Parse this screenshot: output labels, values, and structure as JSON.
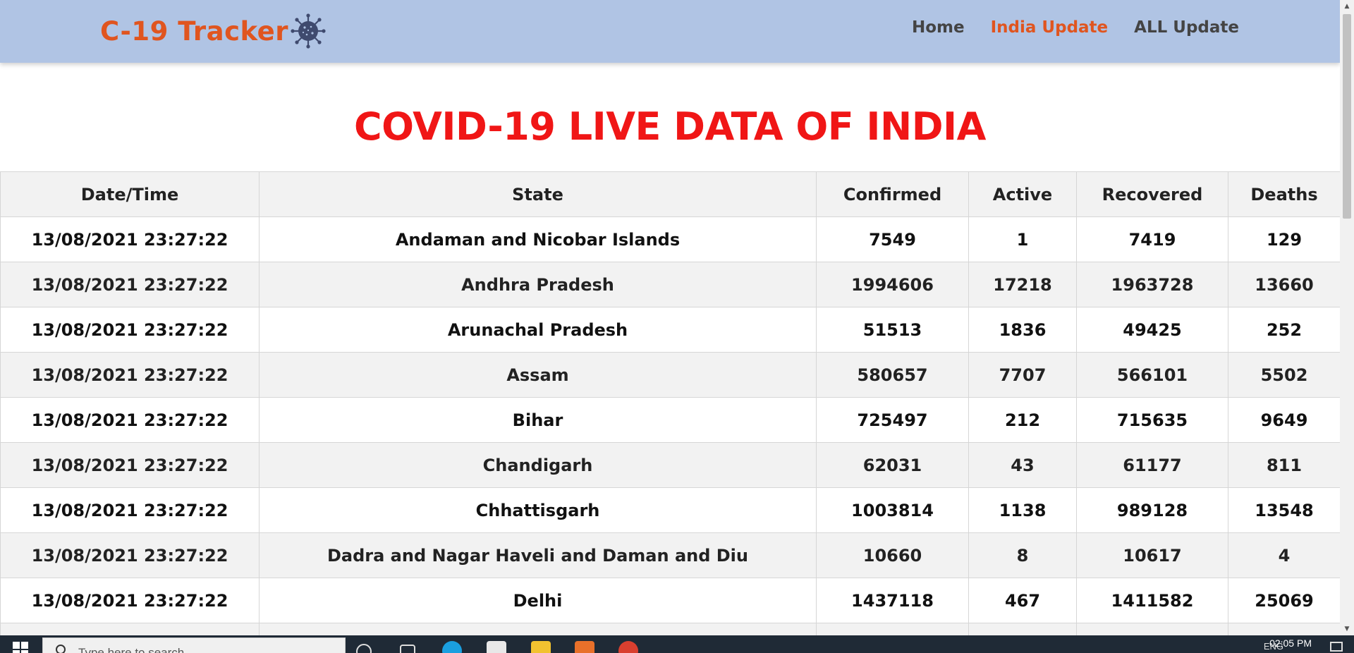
{
  "navbar": {
    "brand": "C-19 Tracker",
    "brand_icon": "virus-icon",
    "links": [
      {
        "label": "Home",
        "active": false
      },
      {
        "label": "India Update",
        "active": true
      },
      {
        "label": "ALL Update",
        "active": false
      }
    ]
  },
  "heading": "COVID-19 LIVE DATA OF INDIA",
  "table": {
    "columns": [
      "Date/Time",
      "State",
      "Confirmed",
      "Active",
      "Recovered",
      "Deaths"
    ],
    "rows": [
      {
        "datetime": "13/08/2021 23:27:22",
        "state": "Andaman and Nicobar Islands",
        "confirmed": "7549",
        "active": "1",
        "recovered": "7419",
        "deaths": "129"
      },
      {
        "datetime": "13/08/2021 23:27:22",
        "state": "Andhra Pradesh",
        "confirmed": "1994606",
        "active": "17218",
        "recovered": "1963728",
        "deaths": "13660"
      },
      {
        "datetime": "13/08/2021 23:27:22",
        "state": "Arunachal Pradesh",
        "confirmed": "51513",
        "active": "1836",
        "recovered": "49425",
        "deaths": "252"
      },
      {
        "datetime": "13/08/2021 23:27:22",
        "state": "Assam",
        "confirmed": "580657",
        "active": "7707",
        "recovered": "566101",
        "deaths": "5502"
      },
      {
        "datetime": "13/08/2021 23:27:22",
        "state": "Bihar",
        "confirmed": "725497",
        "active": "212",
        "recovered": "715635",
        "deaths": "9649"
      },
      {
        "datetime": "13/08/2021 23:27:22",
        "state": "Chandigarh",
        "confirmed": "62031",
        "active": "43",
        "recovered": "61177",
        "deaths": "811"
      },
      {
        "datetime": "13/08/2021 23:27:22",
        "state": "Chhattisgarh",
        "confirmed": "1003814",
        "active": "1138",
        "recovered": "989128",
        "deaths": "13548"
      },
      {
        "datetime": "13/08/2021 23:27:22",
        "state": "Dadra and Nagar Haveli and Daman and Diu",
        "confirmed": "10660",
        "active": "8",
        "recovered": "10617",
        "deaths": "4"
      },
      {
        "datetime": "13/08/2021 23:27:22",
        "state": "Delhi",
        "confirmed": "1437118",
        "active": "467",
        "recovered": "1411582",
        "deaths": "25069"
      },
      {
        "datetime": "",
        "state": "",
        "confirmed": "",
        "active": "",
        "recovered": "",
        "deaths": ""
      }
    ]
  },
  "taskbar": {
    "search_placeholder": "Type here to search",
    "language": "ENG",
    "clock": "02:05 PM"
  },
  "colors": {
    "navbar_bg": "#b0c4e4",
    "brand": "#e0551f",
    "heading": "#f01616",
    "row_alt": "#f2f2f2"
  }
}
